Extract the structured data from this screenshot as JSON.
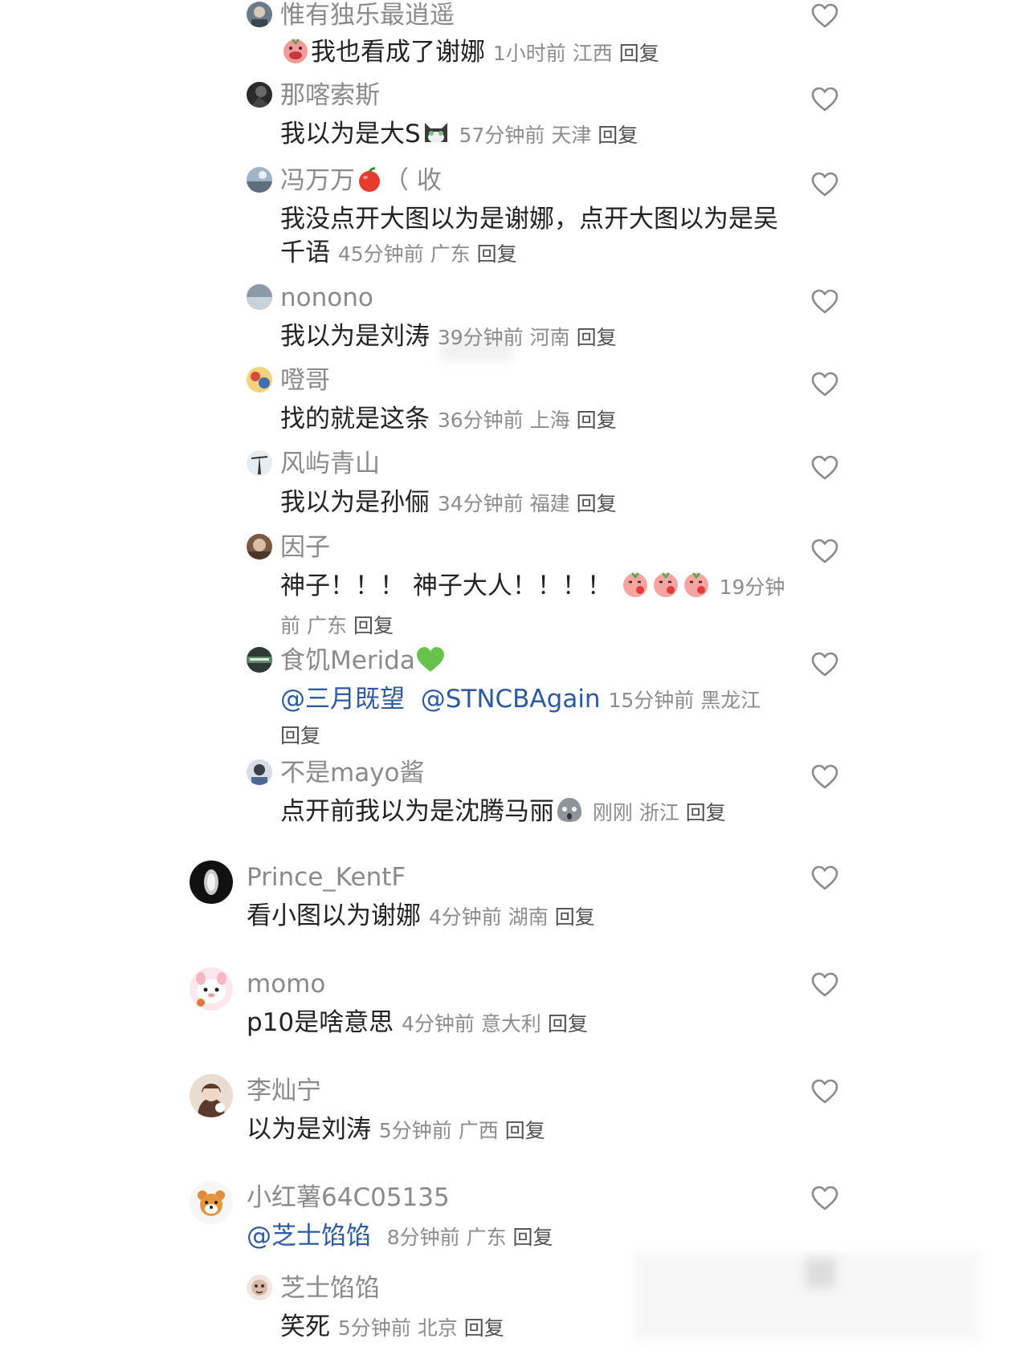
{
  "reply_label": "回复",
  "comments": [
    {
      "user": "惟有独乐最逍遥",
      "text": "我也看成了谢娜",
      "time": "1小时前",
      "location": "江西"
    },
    {
      "user": "那喀索斯",
      "text": "我以为是大S",
      "time": "57分钟前",
      "location": "天津"
    },
    {
      "user": "冯万万",
      "user_suffix": "（ 收",
      "text": "我没点开大图以为是谢娜，点开大图以为是吴千语",
      "time": "45分钟前",
      "location": "广东"
    },
    {
      "user": "nonono",
      "text": "我以为是刘涛",
      "time": "39分钟前",
      "location": "河南"
    },
    {
      "user": "噔哥",
      "text": "找的就是这条",
      "time": "36分钟前",
      "location": "上海"
    },
    {
      "user": "风屿青山",
      "text": "我以为是孙俪",
      "time": "34分钟前",
      "location": "福建"
    },
    {
      "user": "因子",
      "text": "神子！！！ 神子大人！！！！",
      "time": "19分钟前",
      "location": "广东"
    },
    {
      "user": "食饥Merida",
      "mentions": [
        "@三月既望",
        "@STNCBAgain"
      ],
      "time": "15分钟前",
      "location": "黑龙江"
    },
    {
      "user": "不是mayo酱",
      "text": "点开前我以为是沈腾马丽",
      "time": "刚刚",
      "location": "浙江"
    },
    {
      "user": "Prince_KentF",
      "text": "看小图以为谢娜",
      "time": "4分钟前",
      "location": "湖南"
    },
    {
      "user": "momo",
      "text": "p10是啥意思",
      "time": "4分钟前",
      "location": "意大利"
    },
    {
      "user": "李灿宁",
      "text": "以为是刘涛",
      "time": "5分钟前",
      "location": "广西"
    },
    {
      "user": "小红薯64C05135",
      "mentions": [
        "@芝士馅馅"
      ],
      "time": "8分钟前",
      "location": "广东"
    },
    {
      "user": "芝士馅馅",
      "text": "笑死",
      "time": "5分钟前",
      "location": "北京"
    }
  ],
  "icons": {
    "like": "heart-outline-icon",
    "avatar_style": "circular-photo"
  },
  "colors": {
    "username": "#8a8a8a",
    "body": "#222222",
    "meta": "#8c8c8c",
    "mention": "#2d5a9e",
    "heart_stroke": "#8a8a8a"
  }
}
